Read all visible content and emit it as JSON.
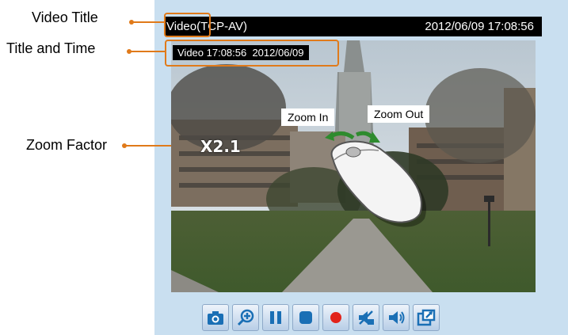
{
  "callouts": {
    "video_title": "Video Title",
    "title_and_time": "Title and Time",
    "zoom_factor": "Zoom Factor"
  },
  "video": {
    "title_prefix": "Video",
    "title_suffix": "(TCP-AV)",
    "datetime": "2012/06/09  17:08:56",
    "overlay_text": "Video 17:08:56  2012/06/09",
    "zoom_factor": "X2.1",
    "zoom_in_label": "Zoom In",
    "zoom_out_label": "Zoom Out"
  },
  "toolbar": {
    "buttons": [
      "snapshot-icon",
      "digital-zoom-icon",
      "pause-icon",
      "stop-icon",
      "record-icon",
      "volume-mute-icon",
      "talk-icon",
      "fullscreen-icon"
    ]
  },
  "colors": {
    "callout_accent": "#e07a1a",
    "panel_bg": "#c9dff0",
    "toolbar_icon": "#1a6fb5",
    "record": "#e2231a"
  }
}
